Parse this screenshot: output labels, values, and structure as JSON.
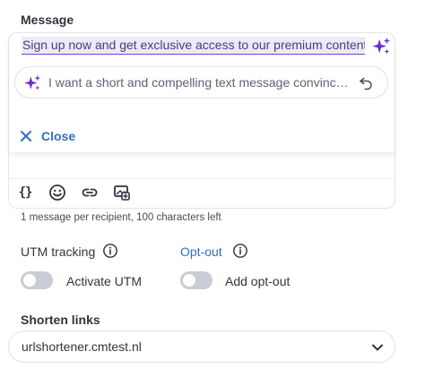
{
  "message": {
    "label": "Message",
    "text": "Sign up now and get exclusive access to our premium content!",
    "prompt": "I want a short and compelling text message convincin...",
    "close_label": "Close",
    "toolbar_braces": "{}",
    "counter": "1 message per recipient, 100 characters left"
  },
  "utm": {
    "label": "UTM tracking",
    "toggle_label": "Activate UTM",
    "enabled": false
  },
  "optout": {
    "label": "Opt-out",
    "toggle_label": "Add opt-out",
    "enabled": false
  },
  "shorten": {
    "label": "Shorten links",
    "selected": "urlshortener.cmtest.nl"
  },
  "colors": {
    "accent": "#2f6fc4",
    "ai_purple": "#6b2fd0",
    "toggle_off": "#c9ccd3"
  },
  "icons": [
    "sparkle-icon",
    "undo-icon",
    "close-icon",
    "variables-icon",
    "emoji-icon",
    "link-icon",
    "media-icon",
    "info-icon",
    "chevron-down-icon"
  ]
}
